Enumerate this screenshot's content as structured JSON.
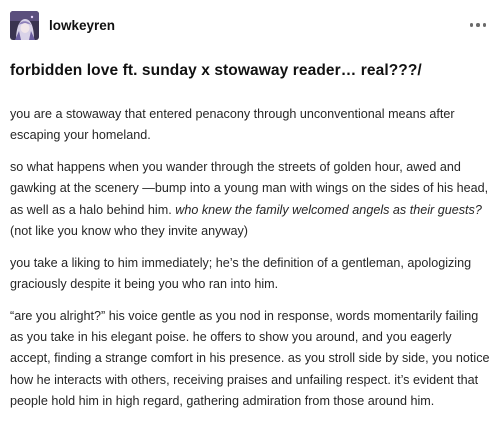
{
  "post": {
    "username": "lowkeyren",
    "more_icon": "ellipsis-icon",
    "title": "forbidden love ft. sunday x stowaway reader… real???/",
    "paragraphs": [
      {
        "text": "you are a stowaway that entered penacony through unconventional means after escaping your homeland."
      },
      {
        "text": "so what happens when you wander through the streets of golden hour, awed and gawking at the scenery —bump into a young man with wings on the sides of his head, as well as a halo behind him. ",
        "italic": "who knew the family welcomed angels as their guests?",
        "tail": " (not like you know who they invite anyway)"
      },
      {
        "text": "you take a liking to him immediately; he’s the definition of a gentleman, apologizing graciously despite it being you who ran into him."
      },
      {
        "text": "“are you alright?” his voice gentle as you nod in response, words momentarily failing as you take in his elegant poise. he offers to show you around, and you eagerly accept, finding a strange comfort in his presence. as you stroll side by side, you notice how he interacts with others, receiving praises and unfailing respect. it’s evident that people hold him in high regard, gathering admiration from those around him."
      }
    ]
  },
  "colors": {
    "text": "#262626",
    "title": "#111111",
    "muted_icon": "#6b6b6b",
    "avatar_bg": "#3a3350"
  }
}
